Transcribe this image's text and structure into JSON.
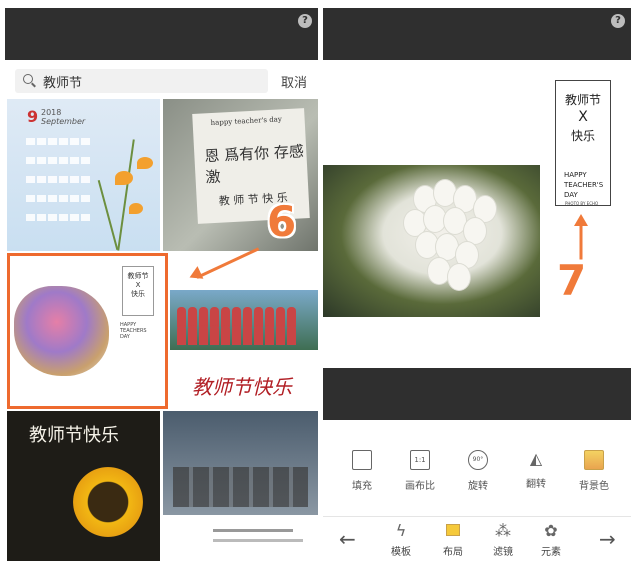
{
  "left": {
    "search": {
      "placeholder": "教师节",
      "cancel_label": "取消"
    },
    "calendar": {
      "month_number": "9",
      "year": "2018",
      "month_name": "September"
    },
    "board_tile": {
      "header": "happy teacher's day",
      "main": "恩 爲有你 存感激",
      "sub": "教 师 节 快 乐"
    },
    "label_card": {
      "top": "教师节",
      "mid": "X",
      "bottom": "快乐",
      "foot": "HAPPY TEACHERS DAY"
    },
    "greeting_cursive": "教师节快乐",
    "sunflower_title": "教师节快乐",
    "annotation_number": "6"
  },
  "right": {
    "sticker": {
      "title": "教师节",
      "mid": "X",
      "sub": "快乐",
      "en1": "HAPPY",
      "en2": "TEACHER'S",
      "en3": "DAY",
      "photo_by": "PHOTO BY ECHO"
    },
    "annotation_number": "7",
    "tools": [
      {
        "label": "填充",
        "icon": "fill-icon"
      },
      {
        "label": "画布比",
        "icon": "aspect-ratio-icon",
        "inner": "1:1"
      },
      {
        "label": "旋转",
        "icon": "rotate-icon",
        "inner": "90°"
      },
      {
        "label": "翻转",
        "icon": "flip-icon"
      },
      {
        "label": "背景色",
        "icon": "background-color-icon"
      }
    ],
    "nav": [
      {
        "label": "模板",
        "icon": "template-icon"
      },
      {
        "label": "布局",
        "icon": "layout-icon"
      },
      {
        "label": "滤镜",
        "icon": "filter-icon"
      },
      {
        "label": "元素",
        "icon": "element-icon"
      }
    ],
    "colors": {
      "annotation": "#f07a3a",
      "dark_bar": "#2f2f2f"
    }
  }
}
